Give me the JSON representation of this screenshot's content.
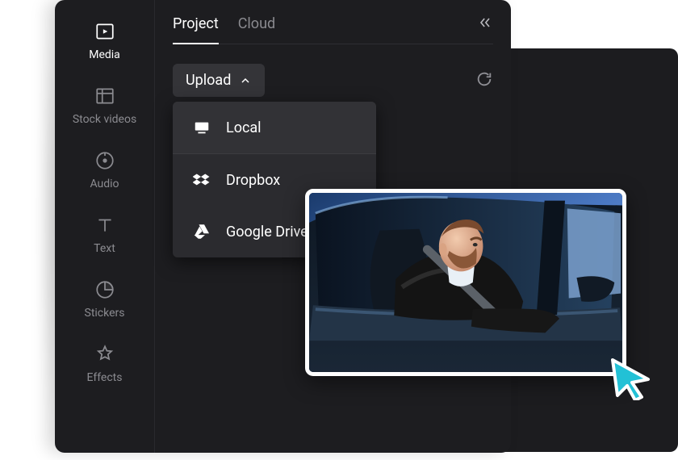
{
  "sidebar": {
    "items": [
      {
        "label": "Media"
      },
      {
        "label": "Stock videos"
      },
      {
        "label": "Audio"
      },
      {
        "label": "Text"
      },
      {
        "label": "Stickers"
      },
      {
        "label": "Effects"
      }
    ]
  },
  "tabs": [
    {
      "label": "Project",
      "active": true
    },
    {
      "label": "Cloud",
      "active": false
    }
  ],
  "upload": {
    "label": "Upload",
    "options": [
      {
        "label": "Local",
        "icon": "monitor-icon"
      },
      {
        "label": "Dropbox",
        "icon": "dropbox-icon"
      },
      {
        "label": "Google Drive",
        "icon": "google-drive-icon"
      }
    ]
  },
  "colors": {
    "panel_bg": "#1d1d20",
    "sidebar_inactive": "#8b8b90",
    "sidebar_active": "#ffffff",
    "dropdown_bg": "#2b2b2f",
    "cursor_accent": "#22c1d6"
  },
  "thumbnail": {
    "description": "Man with beard in black leather jacket sitting in driver seat of a car, seatbelt on, looking out open window",
    "cursor_color": "#22c1d6"
  }
}
